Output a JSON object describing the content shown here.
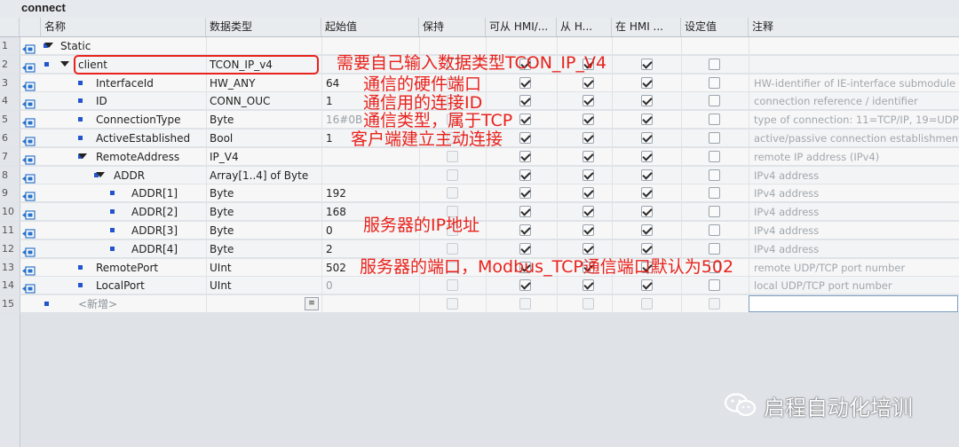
{
  "window": {
    "title": "connect"
  },
  "columns": [
    "名称",
    "数据类型",
    "起始值",
    "保持",
    "可从 HMI/...",
    "从 H...",
    "在 HMI ...",
    "设定值",
    "注释"
  ],
  "rows": [
    {
      "num": "1",
      "name": "Static",
      "type": "",
      "start": "",
      "retain": "",
      "hmi1": "",
      "hmi2": "",
      "hmi3": "",
      "setpoint": "",
      "comment": "",
      "level": 0,
      "expand": true,
      "sq": true
    },
    {
      "num": "2",
      "name": "client",
      "type": "TCON_IP_v4",
      "start": "",
      "retain": "off",
      "hmi1": "on",
      "hmi2": "on",
      "hmi3": "on",
      "setpoint": "off",
      "comment": "",
      "level": 1,
      "expand": true
    },
    {
      "num": "3",
      "name": "InterfaceId",
      "type": "HW_ANY",
      "start": "64",
      "retain": "dis",
      "hmi1": "on",
      "hmi2": "on",
      "hmi3": "on",
      "setpoint": "off",
      "comment": "HW-identifier of IE-interface submodule",
      "level": 2
    },
    {
      "num": "4",
      "name": "ID",
      "type": "CONN_OUC",
      "start": "1",
      "retain": "dis",
      "hmi1": "on",
      "hmi2": "on",
      "hmi3": "on",
      "setpoint": "off",
      "comment": "connection reference / identifier",
      "level": 2
    },
    {
      "num": "5",
      "name": "ConnectionType",
      "type": "Byte",
      "start": "16#0B",
      "retain": "dis",
      "hmi1": "on",
      "hmi2": "on",
      "hmi3": "on",
      "setpoint": "off",
      "comment": "type of connection: 11=TCP/IP, 19=UDP",
      "level": 2,
      "startdim": true
    },
    {
      "num": "6",
      "name": "ActiveEstablished",
      "type": "Bool",
      "start": "1",
      "retain": "dis",
      "hmi1": "on",
      "hmi2": "on",
      "hmi3": "on",
      "setpoint": "off",
      "comment": "active/passive connection establishment",
      "level": 2
    },
    {
      "num": "7",
      "name": "RemoteAddress",
      "type": "IP_V4",
      "start": "",
      "retain": "dis",
      "hmi1": "on",
      "hmi2": "on",
      "hmi3": "on",
      "setpoint": "off",
      "comment": "remote IP address (IPv4)",
      "level": 2,
      "expand": true
    },
    {
      "num": "8",
      "name": "ADDR",
      "type": "Array[1..4] of Byte",
      "start": "",
      "retain": "dis",
      "hmi1": "on",
      "hmi2": "on",
      "hmi3": "on",
      "setpoint": "off",
      "comment": "IPv4 address",
      "level": 3,
      "expand": true
    },
    {
      "num": "9",
      "name": "ADDR[1]",
      "type": "Byte",
      "start": "192",
      "retain": "dis",
      "hmi1": "on",
      "hmi2": "on",
      "hmi3": "on",
      "setpoint": "off",
      "comment": "IPv4 address",
      "level": 4
    },
    {
      "num": "10",
      "name": "ADDR[2]",
      "type": "Byte",
      "start": "168",
      "retain": "dis",
      "hmi1": "on",
      "hmi2": "on",
      "hmi3": "on",
      "setpoint": "off",
      "comment": "IPv4 address",
      "level": 4
    },
    {
      "num": "11",
      "name": "ADDR[3]",
      "type": "Byte",
      "start": "0",
      "retain": "dis",
      "hmi1": "on",
      "hmi2": "on",
      "hmi3": "on",
      "setpoint": "off",
      "comment": "IPv4 address",
      "level": 4
    },
    {
      "num": "12",
      "name": "ADDR[4]",
      "type": "Byte",
      "start": "2",
      "retain": "dis",
      "hmi1": "on",
      "hmi2": "on",
      "hmi3": "on",
      "setpoint": "off",
      "comment": "IPv4 address",
      "level": 4
    },
    {
      "num": "13",
      "name": "RemotePort",
      "type": "UInt",
      "start": "502",
      "retain": "dis",
      "hmi1": "on",
      "hmi2": "on",
      "hmi3": "on",
      "setpoint": "off",
      "comment": "remote UDP/TCP port number",
      "level": 2
    },
    {
      "num": "14",
      "name": "LocalPort",
      "type": "UInt",
      "start": "0",
      "retain": "dis",
      "hmi1": "on",
      "hmi2": "on",
      "hmi3": "on",
      "setpoint": "off",
      "comment": "local UDP/TCP port number",
      "level": 2,
      "startdim": true
    },
    {
      "num": "15",
      "name": "<新增>",
      "type": "",
      "start": "",
      "retain": "dis",
      "hmi1": "dis",
      "hmi2": "dis",
      "hmi3": "dis",
      "setpoint": "dis",
      "comment": "",
      "level": 1,
      "newrow": true
    }
  ],
  "annotations": {
    "a1": "需要自己输入数据类型TCON_IP_V4",
    "a2": "通信的硬件端口",
    "a3": "通信用的连接ID",
    "a4": "通信类型，属于TCP",
    "a5": "客户端建立主动连接",
    "a6": "服务器的IP地址",
    "a7": "服务器的端口，Modbus_TCP通信端口默认为502"
  },
  "watermark": "启程自动化培训",
  "colors": {
    "annotation": "#e8221c",
    "selection": "#2255cc"
  }
}
